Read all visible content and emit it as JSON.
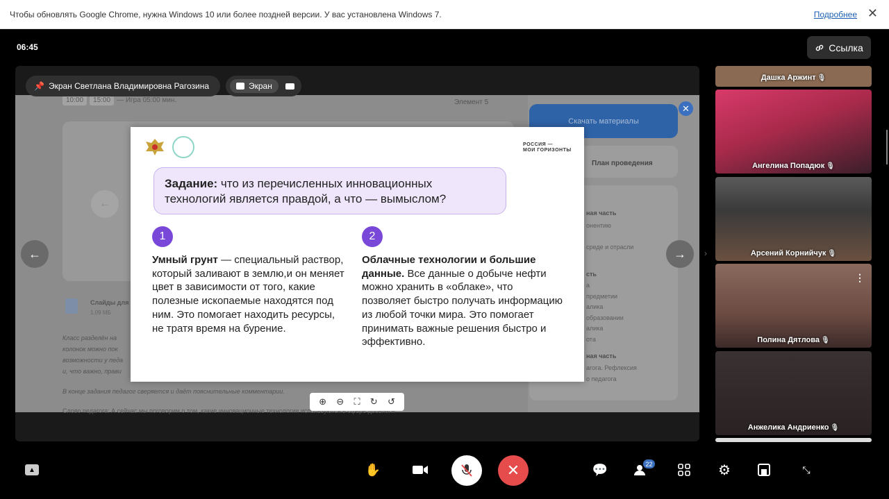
{
  "infobar": {
    "message": "Чтобы обновлять Google Chrome, нужна Windows 10 или более поздней версии. У вас установлена Windows 7.",
    "more_link": "Подробнее",
    "close": "✕"
  },
  "header": {
    "timer": "06:45",
    "link_button": "Ссылка"
  },
  "share": {
    "presenter_label": "Экран Светлана Владимировна Рагозина",
    "screen_tab": "Экран"
  },
  "lms": {
    "chip_time_1": "10:00",
    "chip_time_2": "15:00",
    "top_text": "— Игра 05:00 мин.",
    "element": "Элемент 5",
    "download": "Скачать материалы",
    "plan": "План проведения",
    "file_title": "Слайды для к",
    "file_size": "1.09 МБ",
    "text_lines": [
      "Класс разделён на",
      "колонок можно пок",
      "возможности у педа",
      "и, что важно, прави"
    ],
    "text_bottom": "В конце задания педагог сверяется и даёт пояснительные комментарии.",
    "text_last": "Слово педагога: А сейчас мы поговорим о том, какие инновационные технологии используются в сфере добычи и",
    "side_items": [
      "ная часть",
      "онентию",
      "среде и отрасли",
      "сть",
      "а",
      "предметии",
      "алика",
      "образовании",
      "алика",
      "ота",
      "ная часть",
      "агогa. Рефлексия",
      "о педагога"
    ]
  },
  "slide": {
    "brand_line1": "РОССИЯ —",
    "brand_line2": "МОИ ГОРИЗОНТЫ",
    "task_bold": "Задание:",
    "task_rest": " что из перечисленных инновационных технологий является правдой, а что — вымыслом?",
    "col1": {
      "num": "1",
      "bold": "Умный грунт",
      "text": " — специальный раствор, который заливают в землю,и он меняет цвет в зависимости от того, какие полезные ископаемые находятся под ним. Это помогает находить ресурсы, не тратя время на бурение."
    },
    "col2": {
      "num": "2",
      "bold": "Облачные технологии и большие данные.",
      "text": " Все данные о добыче нефти можно хранить в «облаке», что позволяет быстро получать информацию из любой точки мира. Это помогает принимать важные решения быстро и эффективно."
    }
  },
  "zoombar": [
    "⊕",
    "⊖",
    "⛶",
    "↻",
    "↺"
  ],
  "participants": [
    {
      "name": "Дашка Аржинт",
      "bg": "#8a6a52"
    },
    {
      "name": "Ангелина Попадюк",
      "bg": "#b8364f"
    },
    {
      "name": "Арсений Корнийчук",
      "bg": "#4a4a4a"
    },
    {
      "name": "Полина Дятлова",
      "bg": "#7d5a4e"
    },
    {
      "name": "Анжелика Андриенко",
      "bg": "#3a3030"
    }
  ],
  "toolbar": {
    "participants_count": "22"
  },
  "colors": {
    "accent": "#7a48d8",
    "hangup": "#e74c4c",
    "download": "#2f63a8"
  }
}
